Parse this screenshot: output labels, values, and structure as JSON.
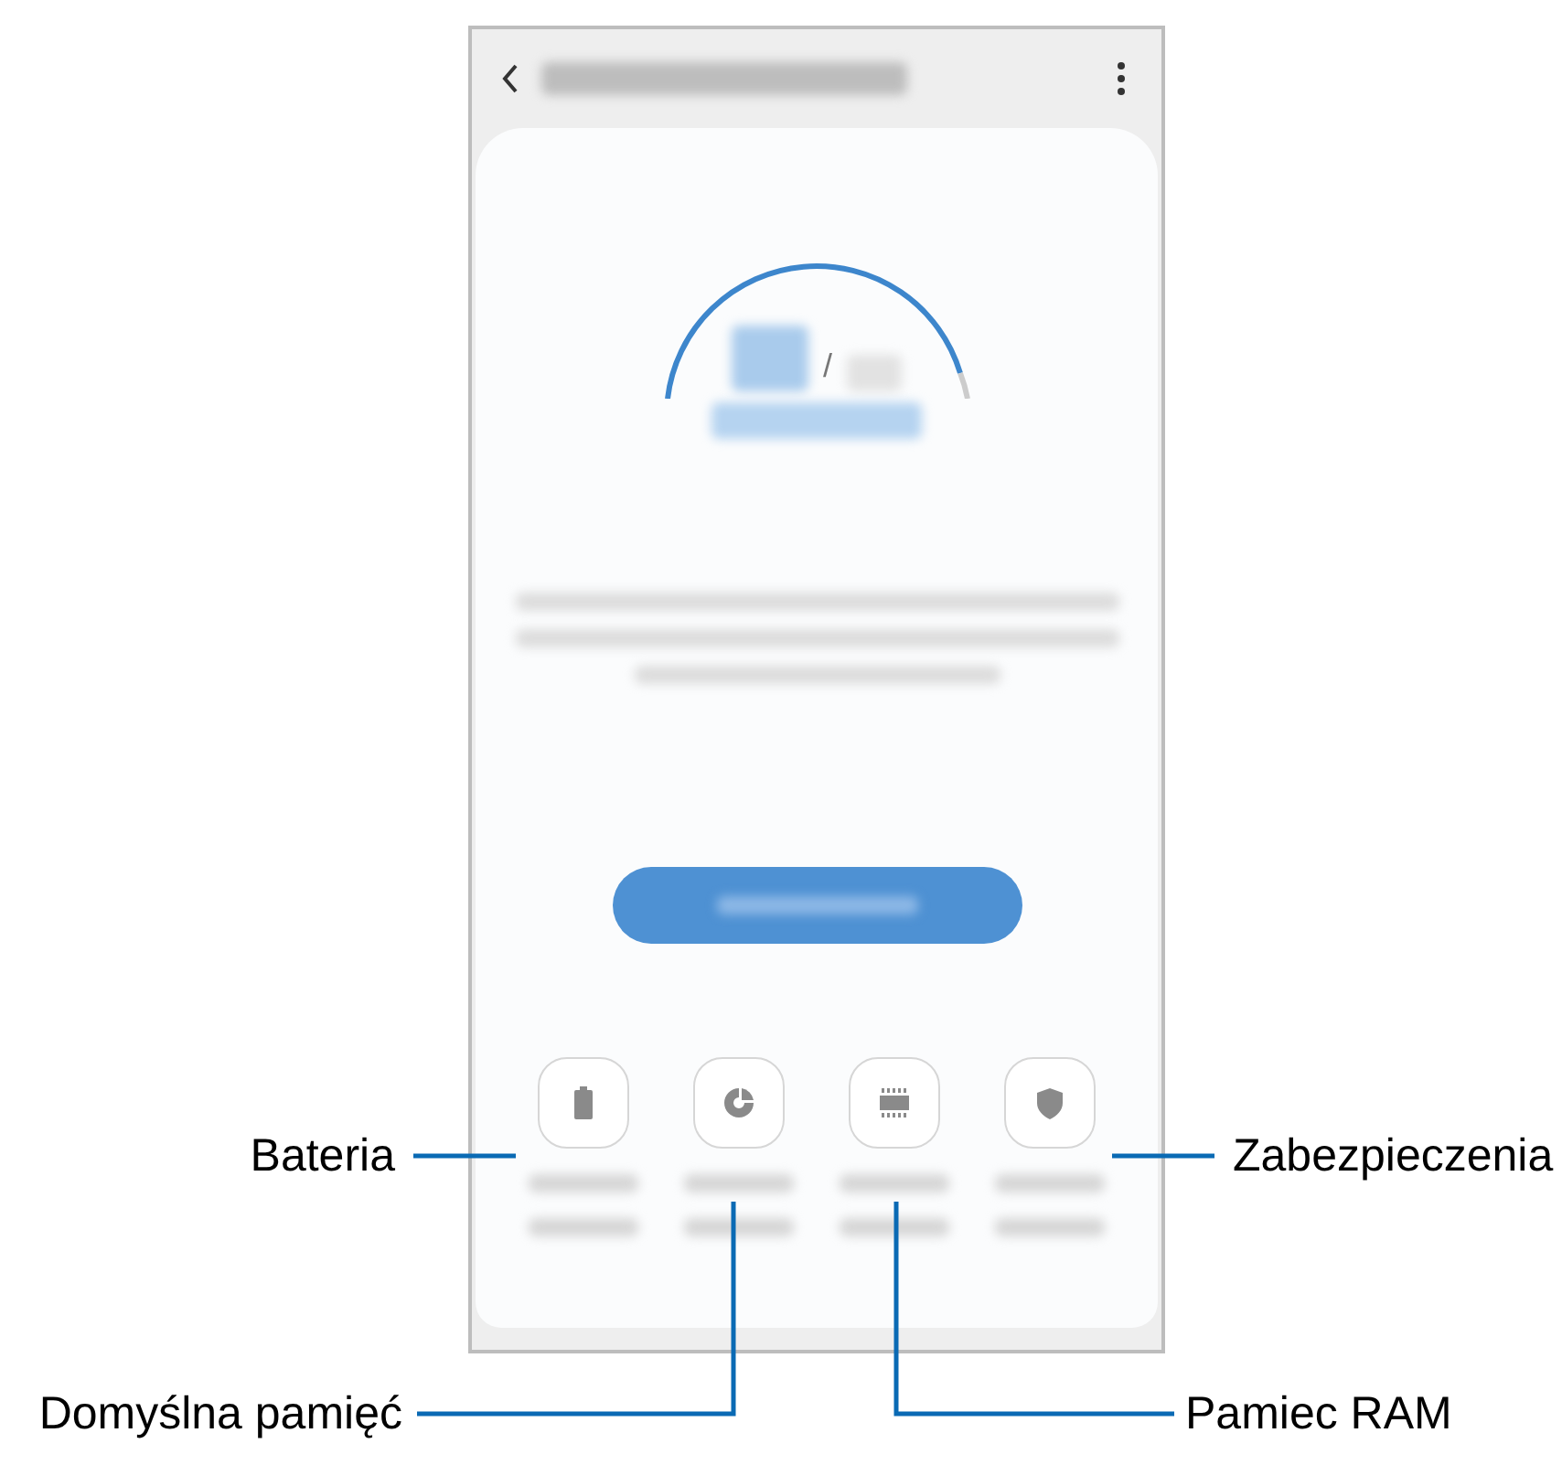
{
  "screen": {
    "score_separator": "/"
  },
  "callouts": [
    {
      "label": "Bateria"
    },
    {
      "label": "Domyślna pamięć"
    },
    {
      "label": "Pamiec RAM"
    },
    {
      "label": "Zabezpieczenia"
    }
  ]
}
